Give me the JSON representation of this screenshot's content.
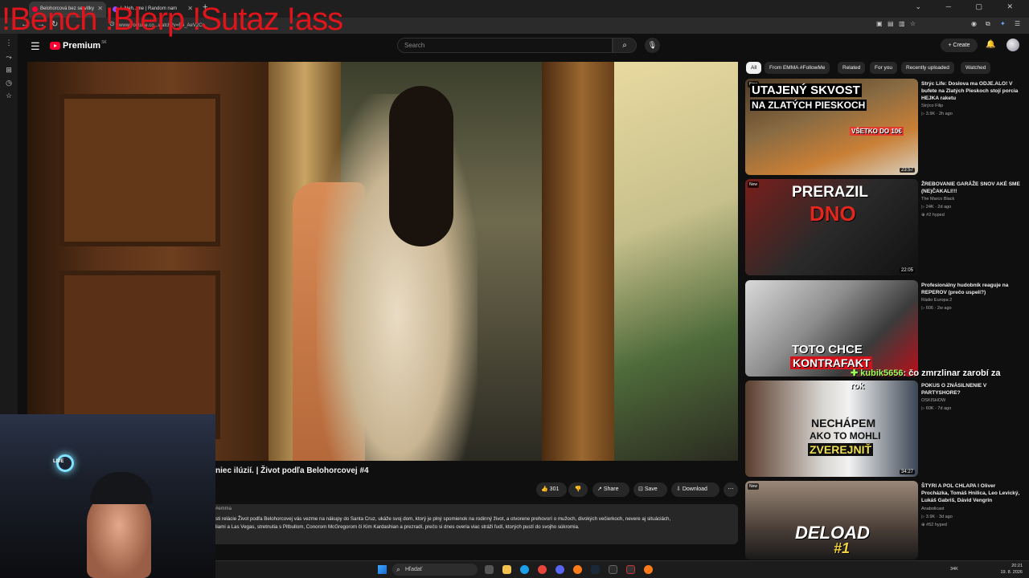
{
  "browser": {
    "tabs": [
      {
        "label": "Belohorcová bez servítky"
      },
      {
        "label": "L Neh...me | Random nam"
      }
    ],
    "new_tab": "+",
    "window_controls": "⌄ ─ ▢ ✕",
    "url": "www.youtube.co...watch?v=F4_AeV2Cs",
    "overlay_text": "!Bench !Blerp !Sutaz !ass"
  },
  "header": {
    "logo_word": "Premium",
    "logo_region": "SK",
    "search_placeholder": "Search",
    "create_label": "Create"
  },
  "video": {
    "title": "niec ilúzií. | Život podľa Belohorcovej #4",
    "likes": "301",
    "share_label": "Share",
    "save_label": "Save",
    "download_label": "Download",
    "description_tag": "#emma",
    "description_line1": "sti relácie Život podľa Belohorcovej vás vezme na nákupy do Santa Cruz, ukáže svoj dom, ktorý je plný spomienok na rodinný život, a otvorene prehovorí o mužoch, divokých večierkoch, nevere aj situáciách,",
    "description_line2": "liami a Las Vegas, stretnutia s Pitbullom, Conorom McGregorom či Kim Kardashian a prezradí, prečo si dnes overia viac stráži ľudí, ktorých pustí do svojho súkromia."
  },
  "chips": [
    {
      "label": "All",
      "active": true
    },
    {
      "label": "From EMMA #FollowMe",
      "active": false
    },
    {
      "label": "Related",
      "active": false
    },
    {
      "label": "For you",
      "active": false
    },
    {
      "label": "Recently uploaded",
      "active": false
    },
    {
      "label": "Watched",
      "active": false
    }
  ],
  "recommendations": [
    {
      "title": "Strýc Life: Doslova ma ODJE.ALO! V bufete na Zlatých Pieskoch stojí porcia HEJKA raketu",
      "channel": "Strýco Filip",
      "meta": "▷ 3.9K · 2h ago",
      "duration": "23:57",
      "badge": "New",
      "thumb_text": "UTAJENÝ SKVOST",
      "thumb_text2": "NA ZLATÝCH PIESKOCH",
      "thumb_text3": "VŠETKO DO 10€"
    },
    {
      "title": "ŽREBOVANIE GARÁŽE SNOV AKÉ SME (NE)ČAKALI!!!",
      "channel": "The Marco Black",
      "meta": "▷ 24K · 2d ago",
      "meta2": "⊕ #2 hyped",
      "duration": "22:05",
      "badge": "New",
      "thumb_text": "PRERAZIL",
      "thumb_text2": "DNO"
    },
    {
      "title": "Profesionálny hudobník reaguje na REPEROV (prečo uspeli?)",
      "channel": "Rádio Europa 2",
      "meta": "▷ 606 · 2w ago",
      "duration": "",
      "badge": "",
      "thumb_text": "TOTO CHCE",
      "thumb_text2": "KONTRAFAKT"
    },
    {
      "title": "POKUS O ZNÁSILNENIE V PARTYSHORE?",
      "channel": "OSKISHOW",
      "meta": "▷ 60K · 7d ago",
      "duration": "34:27",
      "badge": "",
      "thumb_text": "NECHÁPEM",
      "thumb_text2": "AKO TO MOHLI",
      "thumb_text3": "ZVEREJNIŤ"
    },
    {
      "title": "ŠTYRI A POL CHLAPA I Oliver Procházka, Tomáš Hnilica, Leo Levický, Lukáš Gabriš, Dávid Vengrin",
      "channel": "Anabolicast",
      "meta": "▷ 3.9K · 3d ago",
      "meta2": "⊕ #52 hyped",
      "duration": "",
      "badge": "New",
      "thumb_text": "DELOAD",
      "thumb_text2": "#1"
    }
  ],
  "chat": {
    "user": "kubik5656",
    "message": ": čo zmrzlinar zarobí za",
    "message2": "rok"
  },
  "webcam": {
    "live_badge": "LIVE"
  },
  "taskbar": {
    "search_label": "Hľadať",
    "temp": "34K",
    "time": "20:21",
    "date": "19. 8. 2026"
  },
  "colors": {
    "accent": "#ff0033",
    "overlay": "#e0151b",
    "chat_user": "#9aff5a"
  }
}
